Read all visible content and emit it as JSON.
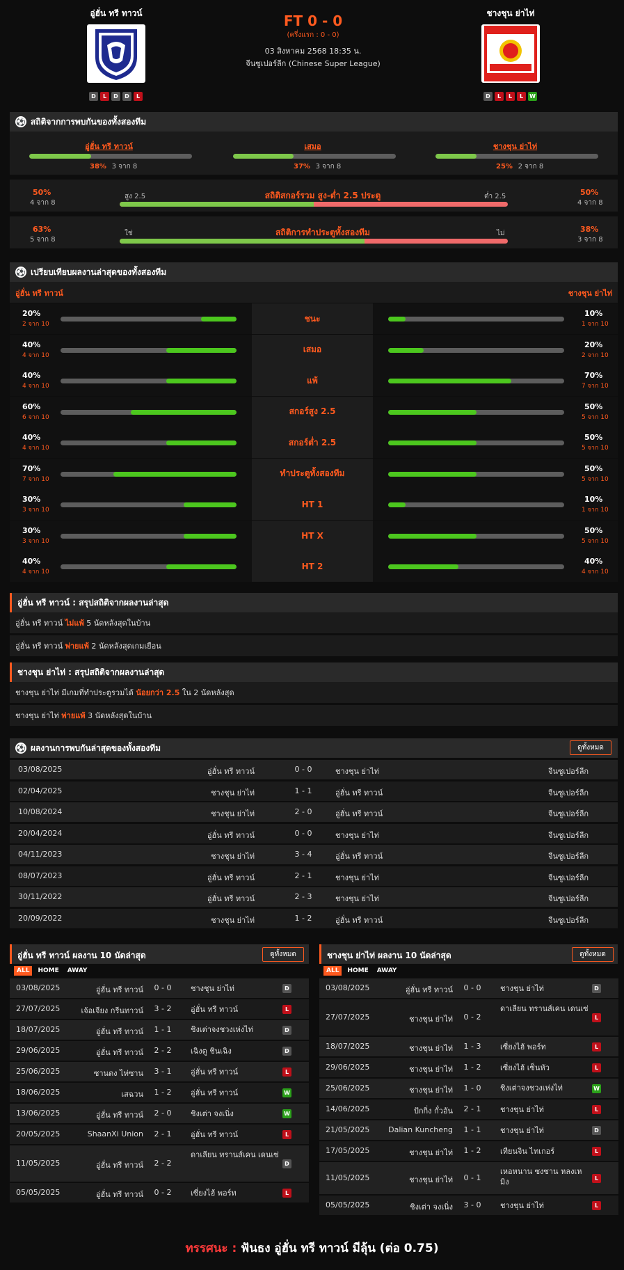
{
  "header": {
    "home_name": "อู่ฮั่น ทรี ทาวน์",
    "away_name": "ชางชุน ย่าไท่",
    "score": "FT 0 - 0",
    "halftime": "(ครึ่งแรก : 0 - 0)",
    "datetime": "03 สิงหาคม 2568 18:35 น.",
    "league": "จีนซูเปอร์ลีก (Chinese Super League)",
    "home_form": [
      "D",
      "L",
      "D",
      "D",
      "L"
    ],
    "away_form": [
      "D",
      "L",
      "L",
      "L",
      "W"
    ],
    "away_logo_text": "CHANGCHUN YATAI FOOTBALL CLUB",
    "away_logo_year": "长春亚泰 1996",
    "home_logo_text": "WUHAN THREE TOWNS FC"
  },
  "h2h_stats": {
    "title": "สถิติจากการพบกันของทั้งสองทีม",
    "home_label": "อู่ฮั่น ทรี ทาวน์",
    "home_pct": "38%",
    "home_sub": "3 จาก 8",
    "home_val": 0.38,
    "draw_label": "เสมอ",
    "draw_pct": "37%",
    "draw_sub": "3 จาก 8",
    "draw_val": 0.37,
    "away_label": "ชางชุน ย่าไท่",
    "away_pct": "25%",
    "away_sub": "2 จาก 8",
    "away_val": 0.25,
    "goals_title": "สถิติสกอร์รวม สูง-ต่ำ 2.5 ประตู",
    "goals_left_pct": "50%",
    "goals_left_sub": "4 จาก 8",
    "goals_over": "สูง 2.5",
    "goals_right_pct": "50%",
    "goals_right_sub": "4 จาก 8",
    "goals_under": "ต่ำ 2.5",
    "goals_val": 0.5,
    "btts_title": "สถิติการทำประตูทั้งสองทีม",
    "btts_left_pct": "63%",
    "btts_left_sub": "5 จาก 8",
    "btts_yes": "ใช่",
    "btts_right_pct": "38%",
    "btts_right_sub": "3 จาก 8",
    "btts_no": "ไม่",
    "btts_val": 0.63
  },
  "compare": {
    "title": "เปรียบเทียบผลงานล่าสุดของทั้งสองทีม",
    "home": "อู่ฮั่น ทรี ทาวน์",
    "away": "ชางชุน ย่าไท่",
    "rows": [
      {
        "label": "ชนะ",
        "hp": "20%",
        "hs": "2 จาก 10",
        "hv": 0.2,
        "ap": "10%",
        "as": "1 จาก 10",
        "av": 0.1
      },
      {
        "label": "เสมอ",
        "hp": "40%",
        "hs": "4 จาก 10",
        "hv": 0.4,
        "ap": "20%",
        "as": "2 จาก 10",
        "av": 0.2
      },
      {
        "label": "แพ้",
        "hp": "40%",
        "hs": "4 จาก 10",
        "hv": 0.4,
        "ap": "70%",
        "as": "7 จาก 10",
        "av": 0.7
      },
      {
        "label": "สกอร์สูง 2.5",
        "hp": "60%",
        "hs": "6 จาก 10",
        "hv": 0.6,
        "ap": "50%",
        "as": "5 จาก 10",
        "av": 0.5
      },
      {
        "label": "สกอร์ต่ำ 2.5",
        "hp": "40%",
        "hs": "4 จาก 10",
        "hv": 0.4,
        "ap": "50%",
        "as": "5 จาก 10",
        "av": 0.5
      },
      {
        "label": "ทำประตูทั้งสองทีม",
        "hp": "70%",
        "hs": "7 จาก 10",
        "hv": 0.7,
        "ap": "50%",
        "as": "5 จาก 10",
        "av": 0.5
      },
      {
        "label": "HT 1",
        "hp": "30%",
        "hs": "3 จาก 10",
        "hv": 0.3,
        "ap": "10%",
        "as": "1 จาก 10",
        "av": 0.1
      },
      {
        "label": "HT X",
        "hp": "30%",
        "hs": "3 จาก 10",
        "hv": 0.3,
        "ap": "50%",
        "as": "5 จาก 10",
        "av": 0.5
      },
      {
        "label": "HT 2",
        "hp": "40%",
        "hs": "4 จาก 10",
        "hv": 0.4,
        "ap": "40%",
        "as": "4 จาก 10",
        "av": 0.4
      }
    ]
  },
  "summary_home": {
    "title": "อู่ฮั่น ทรี ทาวน์ : สรุปสถิติจากผลงานล่าสุด",
    "l1a": "อู่ฮั่น ทรี ทาวน์",
    "l1b": "ไม่แพ้",
    "l1c": "5  นัดหลังสุดในบ้าน",
    "l2a": "อู่ฮั่น ทรี ทาวน์",
    "l2b": "พ่ายแพ้",
    "l2c": "2  นัดหลังสุดเกมเยือน"
  },
  "summary_away": {
    "title": "ชางชุน ย่าไท่ : สรุปสถิติจากผลงานล่าสุด",
    "l1a": "ชางชุน ย่าไท่  มีเกมที่ทำประตูรวมได้",
    "l1b": "น้อยกว่า  2.5",
    "l1c": "ใน 2 นัดหลังสุด",
    "l2a": "ชางชุน ย่าไท่",
    "l2b": "พ่ายแพ้",
    "l2c": "3  นัดหลังสุดในบ้าน"
  },
  "h2h": {
    "title": "ผลงานการพบกันล่าสุดของทั้งสองทีม",
    "view_all": "ดูทั้งหมด",
    "rows": [
      {
        "date": "03/08/2025",
        "home": "อู่ฮั่น ทรี ทาวน์",
        "score": "0 - 0",
        "away": "ชางชุน ย่าไท่",
        "league": "จีนซูเปอร์ลีก"
      },
      {
        "date": "02/04/2025",
        "home": "ชางชุน ย่าไท่",
        "score": "1 - 1",
        "away": "อู่ฮั่น ทรี ทาวน์",
        "league": "จีนซูเปอร์ลีก"
      },
      {
        "date": "10/08/2024",
        "home": "ชางชุน ย่าไท่",
        "score": "2 - 0",
        "away": "อู่ฮั่น ทรี ทาวน์",
        "league": "จีนซูเปอร์ลีก"
      },
      {
        "date": "20/04/2024",
        "home": "อู่ฮั่น ทรี ทาวน์",
        "score": "0 - 0",
        "away": "ชางชุน ย่าไท่",
        "league": "จีนซูเปอร์ลีก"
      },
      {
        "date": "04/11/2023",
        "home": "ชางชุน ย่าไท่",
        "score": "3 - 4",
        "away": "อู่ฮั่น ทรี ทาวน์",
        "league": "จีนซูเปอร์ลีก"
      },
      {
        "date": "08/07/2023",
        "home": "อู่ฮั่น ทรี ทาวน์",
        "score": "2 - 1",
        "away": "ชางชุน ย่าไท่",
        "league": "จีนซูเปอร์ลีก"
      },
      {
        "date": "30/11/2022",
        "home": "อู่ฮั่น ทรี ทาวน์",
        "score": "2 - 3",
        "away": "ชางชุน ย่าไท่",
        "league": "จีนซูเปอร์ลีก"
      },
      {
        "date": "20/09/2022",
        "home": "ชางชุน ย่าไท่",
        "score": "1 - 2",
        "away": "อู่ฮั่น ทรี ทาวน์",
        "league": "จีนซูเปอร์ลีก"
      }
    ]
  },
  "last10_home": {
    "title": "อู่ฮั่น ทรี ทาวน์ ผลงาน 10 นัดล่าสุด",
    "view_all": "ดูทั้งหมด",
    "tabs": [
      "ALL",
      "HOME",
      "AWAY"
    ],
    "rows": [
      {
        "date": "03/08/2025",
        "home": "อู่ฮั่น ทรี ทาวน์",
        "score": "0 - 0",
        "away": "ชางชุน ย่าไท่",
        "r": "D"
      },
      {
        "date": "27/07/2025",
        "home": "เจ้อเจียง กรีนทาวน์",
        "score": "3 - 2",
        "away": "อู่ฮั่น ทรี ทาวน์",
        "r": "L"
      },
      {
        "date": "18/07/2025",
        "home": "อู่ฮั่น ทรี ทาวน์",
        "score": "1 - 1",
        "away": "ชิงเต่าจงชวงเห่งไท่",
        "r": "D"
      },
      {
        "date": "29/06/2025",
        "home": "อู่ฮั่น ทรี ทาวน์",
        "score": "2 - 2",
        "away": "เฉิงตู ชินเฉิง",
        "r": "D"
      },
      {
        "date": "25/06/2025",
        "home": "ซานตง ไท่ซาน",
        "score": "3 - 1",
        "away": "อู่ฮั่น ทรี ทาวน์",
        "r": "L"
      },
      {
        "date": "18/06/2025",
        "home": "เสฉวน",
        "score": "1 - 2",
        "away": "อู่ฮั่น ทรี ทาวน์",
        "r": "W"
      },
      {
        "date": "13/06/2025",
        "home": "อู่ฮั่น ทรี ทาวน์",
        "score": "2 - 0",
        "away": "ชิงเต่า จงเนิ่ง",
        "r": "W"
      },
      {
        "date": "20/05/2025",
        "home": "ShaanXi Union",
        "score": "2 - 1",
        "away": "อู่ฮั่น ทรี ทาวน์",
        "r": "L"
      },
      {
        "date": "11/05/2025",
        "home": "อู่ฮั่น ทรี ทาวน์",
        "score": "2 - 2",
        "away": "ดาเลียน ทรานส์เคน เดนเซ่",
        "r": "D"
      },
      {
        "date": "05/05/2025",
        "home": "อู่ฮั่น ทรี ทาวน์",
        "score": "0 - 2",
        "away": "เซี่ยงไฮ้ พอร์ท",
        "r": "L"
      }
    ]
  },
  "last10_away": {
    "title": "ชางชุน ย่าไท่ ผลงาน 10 นัดล่าสุด",
    "view_all": "ดูทั้งหมด",
    "tabs": [
      "ALL",
      "HOME",
      "AWAY"
    ],
    "rows": [
      {
        "date": "03/08/2025",
        "home": "อู่ฮั่น ทรี ทาวน์",
        "score": "0 - 0",
        "away": "ชางชุน ย่าไท่",
        "r": "D"
      },
      {
        "date": "27/07/2025",
        "home": "ชางชุน ย่าไท่",
        "score": "0 - 2",
        "away": "ดาเลียน ทรานส์เคน เดนเซ่",
        "r": "L"
      },
      {
        "date": "18/07/2025",
        "home": "ชางชุน ย่าไท่",
        "score": "1 - 3",
        "away": "เซี่ยงไฮ้ พอร์ท",
        "r": "L"
      },
      {
        "date": "29/06/2025",
        "home": "ชางชุน ย่าไท่",
        "score": "1 - 2",
        "away": "เซี่ยงไฮ้ เซ็นหัว",
        "r": "L"
      },
      {
        "date": "25/06/2025",
        "home": "ชางชุน ย่าไท่",
        "score": "1 - 0",
        "away": "ชิงเต่าจงชวงเห่งไท่",
        "r": "W"
      },
      {
        "date": "14/06/2025",
        "home": "ปักกิ่ง กั๋วอัน",
        "score": "2 - 1",
        "away": "ชางชุน ย่าไท่",
        "r": "L"
      },
      {
        "date": "21/05/2025",
        "home": "Dalian Kuncheng",
        "score": "1 - 1",
        "away": "ชางชุน ย่าไท่",
        "r": "D"
      },
      {
        "date": "17/05/2025",
        "home": "ชางชุน ย่าไท่",
        "score": "1 - 2",
        "away": "เทียนจิน ไทเกอร์",
        "r": "L"
      },
      {
        "date": "11/05/2025",
        "home": "ชางชุน ย่าไท่",
        "score": "0 - 1",
        "away": "เหอหนาน ซงซาน หลงเหมิง",
        "r": "L"
      },
      {
        "date": "05/05/2025",
        "home": "ชิงเต่า จงเนิ่ง",
        "score": "3 - 0",
        "away": "ชางชุน ย่าไท่",
        "r": "L"
      }
    ]
  },
  "verdict": {
    "label": "ทรรศนะ :",
    "text": "ฟันธง อู่ฮั่น ทรี ทาวน์ มีลุ้น (ต่อ 0.75)"
  }
}
